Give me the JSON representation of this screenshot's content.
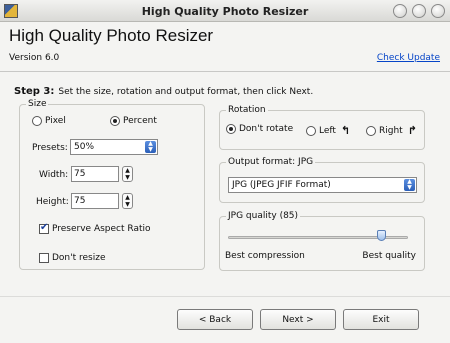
{
  "window": {
    "title": "High Quality Photo Resizer"
  },
  "header": {
    "app_name": "High Quality Photo Resizer",
    "version": "Version 6.0",
    "check_update": "Check Update"
  },
  "step": {
    "label": "Step 3:",
    "instruction": "Set the size, rotation and output format, then click Next."
  },
  "size": {
    "legend": "Size",
    "pixel_label": "Pixel",
    "percent_label": "Percent",
    "selected_mode": "Percent",
    "presets_label": "Presets:",
    "presets_value": "50%",
    "width_label": "Width:",
    "width_value": "75",
    "height_label": "Height:",
    "height_value": "75",
    "preserve_label": "Preserve Aspect Ratio",
    "preserve_checked": true,
    "dont_resize_label": "Don't resize",
    "dont_resize_checked": false
  },
  "rotation": {
    "legend": "Rotation",
    "dont_rotate_label": "Don't rotate",
    "left_label": "Left",
    "right_label": "Right",
    "selected": "Don't rotate"
  },
  "output_format": {
    "legend": "Output format: JPG",
    "value": "JPG (JPEG JFIF Format)"
  },
  "jpg_quality": {
    "legend": "JPG quality (85)",
    "value": 85,
    "min_label": "Best compression",
    "max_label": "Best quality"
  },
  "buttons": {
    "back": "< Back",
    "next": "Next >",
    "exit": "Exit"
  },
  "icons": {
    "app": "photo-resizer-app-icon",
    "rotate_left": "rotate-left-icon",
    "rotate_right": "rotate-right-icon"
  }
}
